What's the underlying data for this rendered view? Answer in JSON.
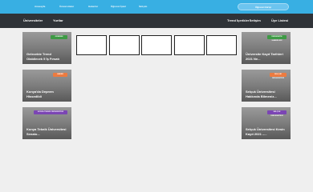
{
  "header": {
    "nav": [
      "Anasayfa",
      "Üniversiteler",
      "Haberler",
      "Öğrenci İşleri",
      "İletişim"
    ],
    "login_button": "Öğrenci Girişi"
  },
  "subnav": {
    "left": [
      "Üniversiteler",
      "Yurtlar"
    ],
    "right": [
      "Trend İçerikler",
      "İletişim",
      "Üye Listesi"
    ]
  },
  "cards": {
    "left": [
      {
        "badge": "GÜNDEM",
        "title": "Gelecekte Trend Olabilecek 5 İş Fırsatı",
        "badge_color": "#3e9a45"
      },
      {
        "badge": "HABER",
        "title": "Konya'da Deprem Hissedildi",
        "badge_color": "#ec7b40"
      },
      {
        "badge": "KONYA TEKNİK ÜNİVERSİTESİ",
        "title": "Konya Teknik Üniversitesi Senato...",
        "badge_color": "#7b45b4"
      }
    ],
    "right": [
      {
        "badge": "ÜNİVERSİTE HABERLERİ",
        "title": "Üniversite Kayıt Tarihleri 2021 Ne...",
        "badge_color": "#3e9a45"
      },
      {
        "badge": "SELÇUK ÜNİVERSİTESİ",
        "title": "Selçuk Üniversitesi Hakkında Bilmeniz...",
        "badge_color": "#ec7b40"
      },
      {
        "badge": "SELÇUK ÜNİVERSİTESİ",
        "title": "Selçuk Üniversitesi Kesin Kayıt 2021 –...",
        "badge_color": "#7b45b4"
      }
    ]
  },
  "colors": {
    "topbar": "#38afe3",
    "subnav": "#2f3338",
    "page_background": "#efefef"
  }
}
